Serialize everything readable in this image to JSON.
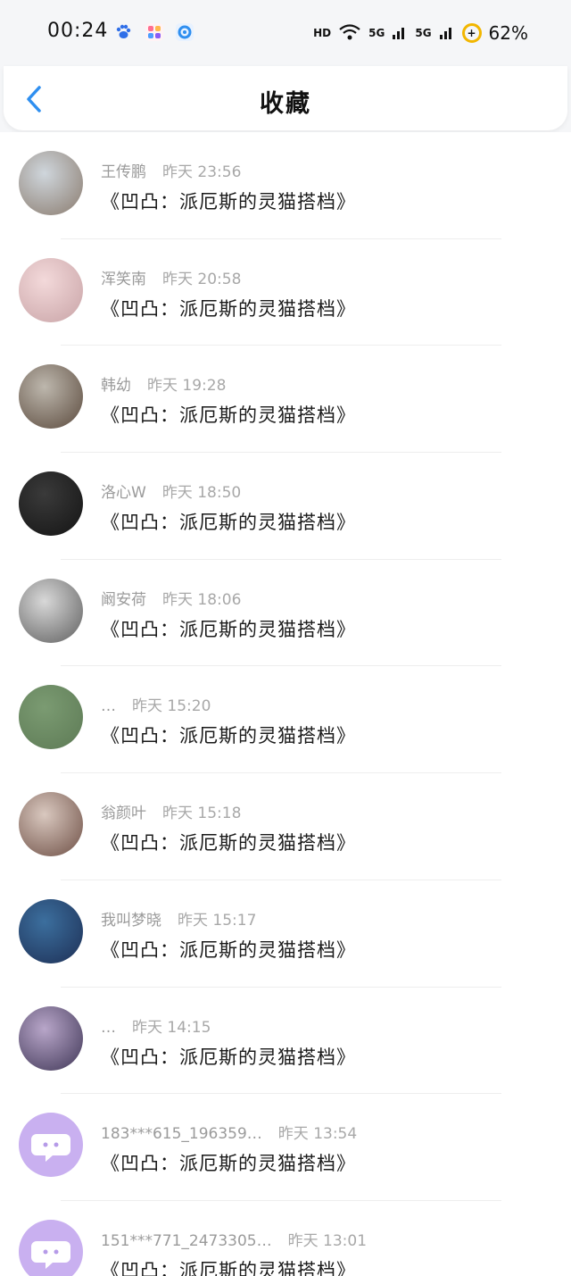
{
  "status_bar": {
    "time": "00:24",
    "network_1": "5G",
    "network_2": "5G",
    "battery_percent": "62%",
    "accent_color": "#f2b600"
  },
  "header": {
    "title": "收藏",
    "back_icon": "chevron-left-icon",
    "back_color": "#2f8ff0"
  },
  "items": [
    {
      "user": "王传鹏",
      "time": "昨天 23:56",
      "title": "《凹凸：派厄斯的灵猫搭档》",
      "avatar": [
        "#cfd6dc",
        "#8a7b6e"
      ]
    },
    {
      "user": "浑笑南",
      "time": "昨天 20:58",
      "title": "《凹凸：派厄斯的灵猫搭档》",
      "avatar": [
        "#f3d9da",
        "#c8a3a6"
      ]
    },
    {
      "user": "韩幼",
      "time": "昨天 19:28",
      "title": "《凹凸：派厄斯的灵猫搭档》",
      "avatar": [
        "#bdb7ad",
        "#5b4a3d"
      ]
    },
    {
      "user": "洛心W",
      "time": "昨天 18:50",
      "title": "《凹凸：派厄斯的灵猫搭档》",
      "avatar": [
        "#3a3a3a",
        "#141414"
      ]
    },
    {
      "user": "阚安荷",
      "time": "昨天 18:06",
      "title": "《凹凸：派厄斯的灵猫搭档》",
      "avatar": [
        "#d8d8d8",
        "#5f5f5f"
      ]
    },
    {
      "user": "…",
      "time": "昨天 15:20",
      "title": "《凹凸：派厄斯的灵猫搭档》",
      "avatar": [
        "#7b9b72",
        "#5d7a55"
      ]
    },
    {
      "user": "翁颜叶",
      "time": "昨天 15:18",
      "title": "《凹凸：派厄斯的灵猫搭档》",
      "avatar": [
        "#d9c8bf",
        "#6e4f45"
      ]
    },
    {
      "user": "我叫梦晓",
      "time": "昨天 15:17",
      "title": "《凹凸：派厄斯的灵猫搭档》",
      "avatar": [
        "#3c6f9e",
        "#1d2f55"
      ]
    },
    {
      "user": "…",
      "time": "昨天 14:15",
      "title": "《凹凸：派厄斯的灵猫搭档》",
      "avatar": [
        "#b8a6c9",
        "#3f3656"
      ]
    },
    {
      "user": "183***615_196359…",
      "time": "昨天 13:54",
      "title": "《凹凸：派厄斯的灵猫搭档》",
      "avatar": [
        "#c9b0f0",
        "#c9b0f0"
      ],
      "default_avatar": true
    },
    {
      "user": "151***771_2473305…",
      "time": "昨天 13:01",
      "title": "《凹凸：派厄斯的灵猫搭档》",
      "avatar": [
        "#c9b0f0",
        "#c9b0f0"
      ],
      "default_avatar": true
    }
  ]
}
